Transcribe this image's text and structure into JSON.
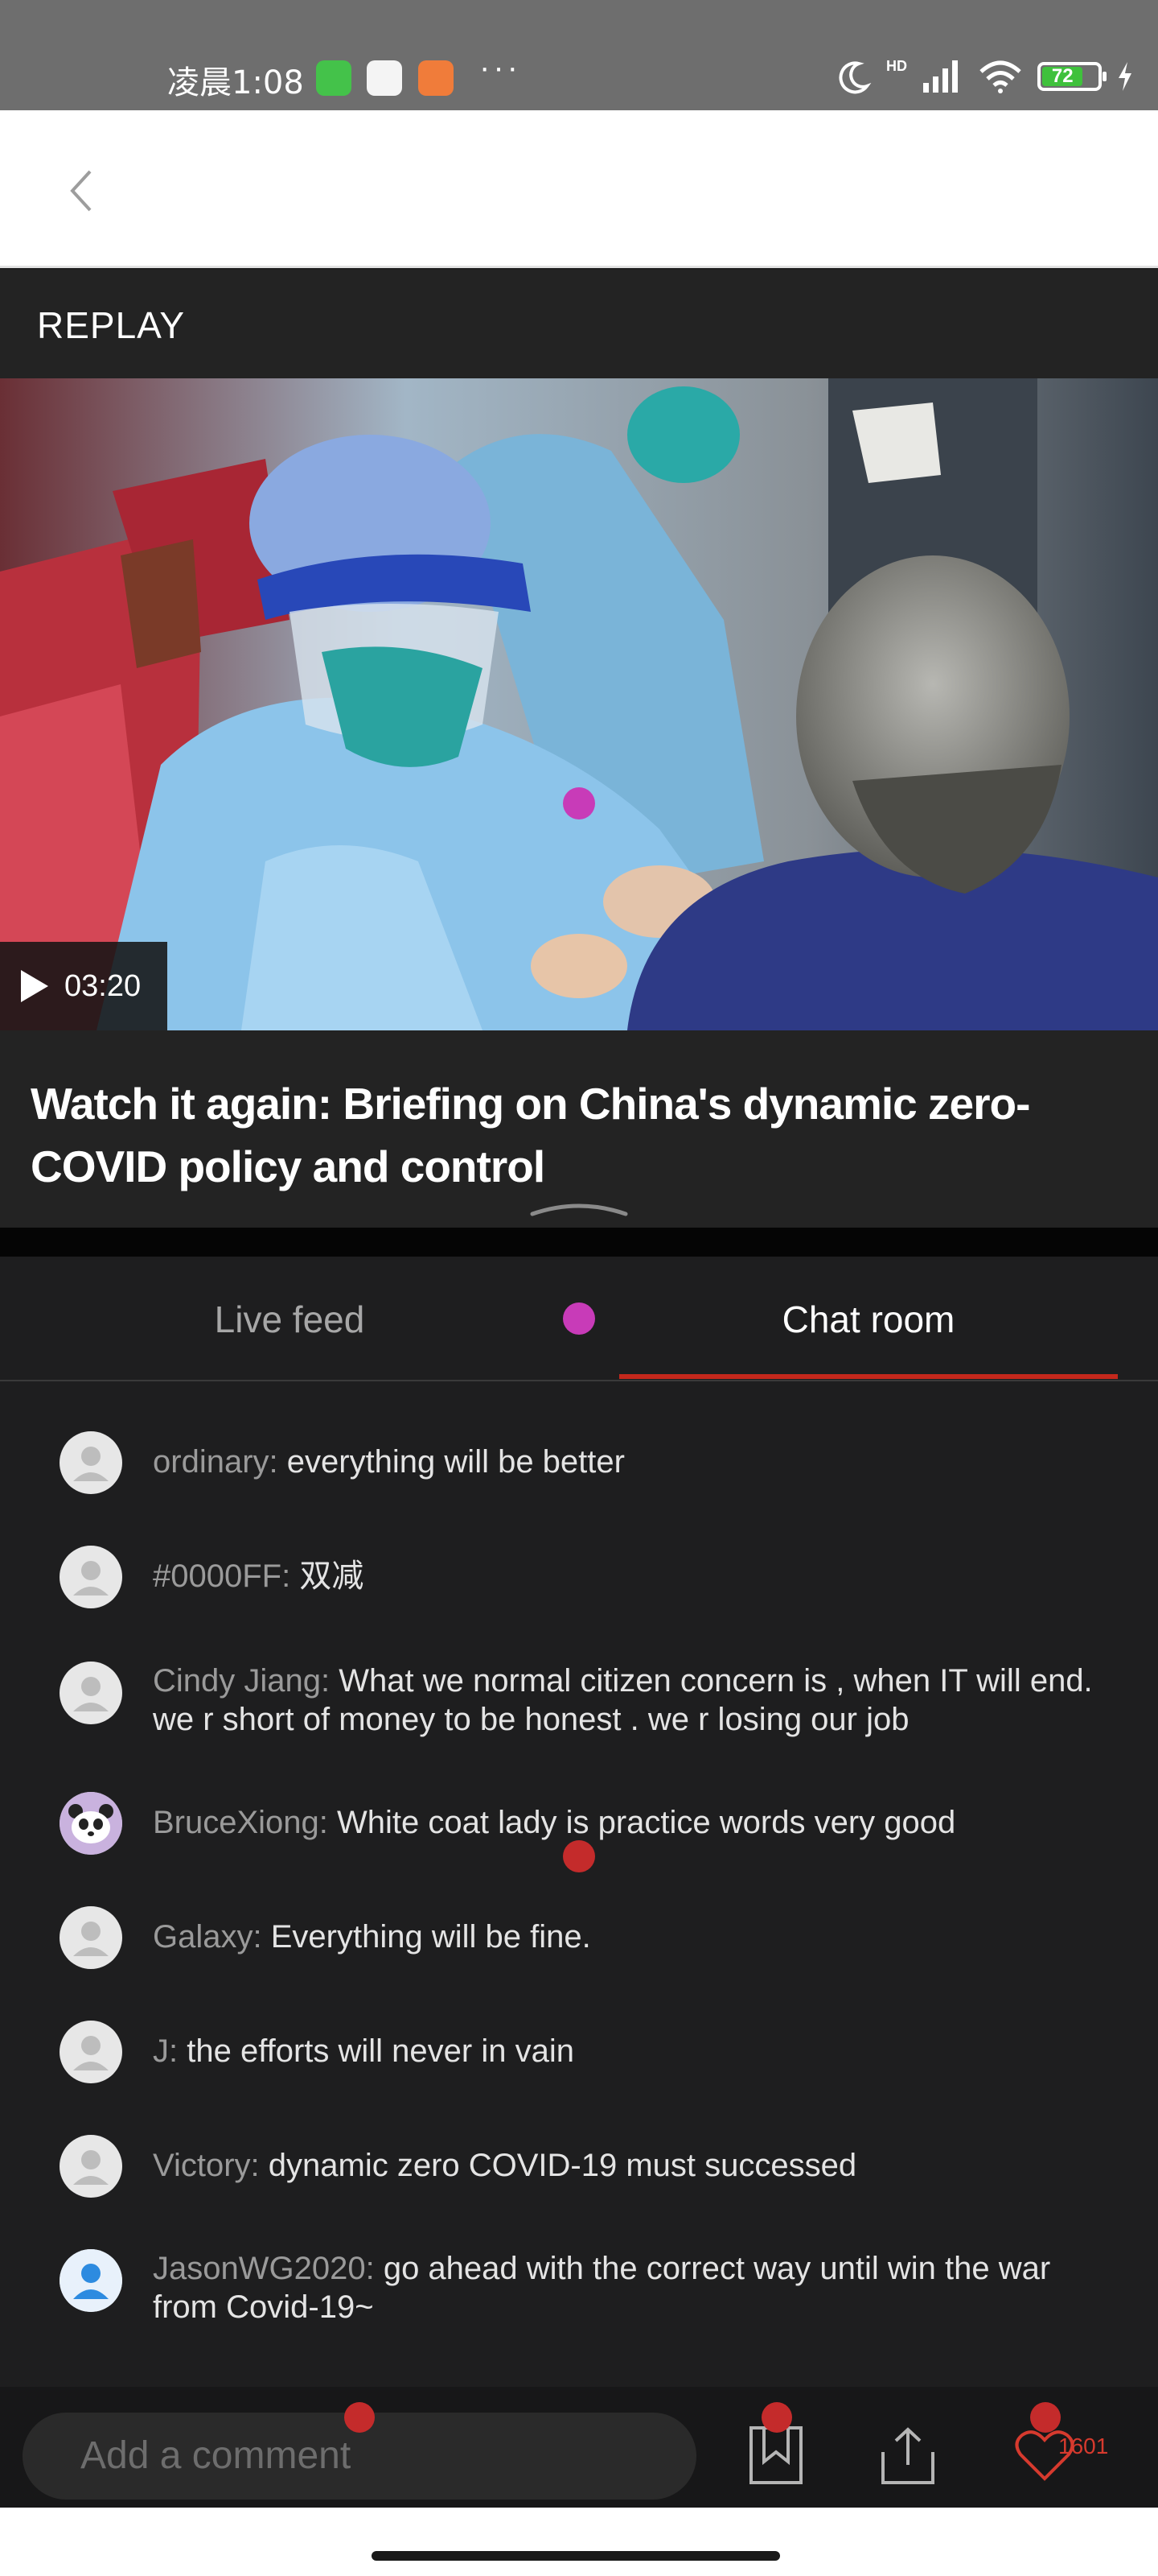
{
  "status_bar": {
    "time": "凌晨1:08",
    "battery": "72",
    "network": "HD",
    "overflow": "···"
  },
  "header": {
    "back_icon": "chevron-left-icon"
  },
  "replay": {
    "label": "REPLAY"
  },
  "video": {
    "duration": "03:20",
    "title": "Watch it again: Briefing on China's dynamic zero-COVID policy and control"
  },
  "tabs": [
    {
      "label": "Live feed",
      "active": false
    },
    {
      "label": "Chat room",
      "active": true
    }
  ],
  "chat": [
    {
      "name": "ordinary:",
      "text": "everything will be better",
      "avatar": "default"
    },
    {
      "name": "#0000FF:",
      "text": "双减",
      "avatar": "default"
    },
    {
      "name": "Cindy Jiang:",
      "text": "What we normal citizen concern is , when IT will end. we r short of money to be honest . we r losing our job",
      "avatar": "default"
    },
    {
      "name": "BruceXiong:",
      "text": "White coat lady is practice  words very good",
      "avatar": "panda"
    },
    {
      "name": "Galaxy:",
      "text": "Everything will be fine.",
      "avatar": "default"
    },
    {
      "name": "J:",
      "text": "the efforts will never in vain",
      "avatar": "default"
    },
    {
      "name": "Victory:",
      "text": "dynamic zero COVID-19 must successed",
      "avatar": "default"
    },
    {
      "name": "JasonWG2020:",
      "text": "go ahead with the correct way until win the war from Covid-19~",
      "avatar": "blue"
    }
  ],
  "bottom": {
    "comment_placeholder": "Add a comment",
    "like_count": "1601"
  },
  "colors": {
    "accent": "#c4281c",
    "background": "#1e1e1f",
    "marker_magenta": "#c83bb8"
  }
}
